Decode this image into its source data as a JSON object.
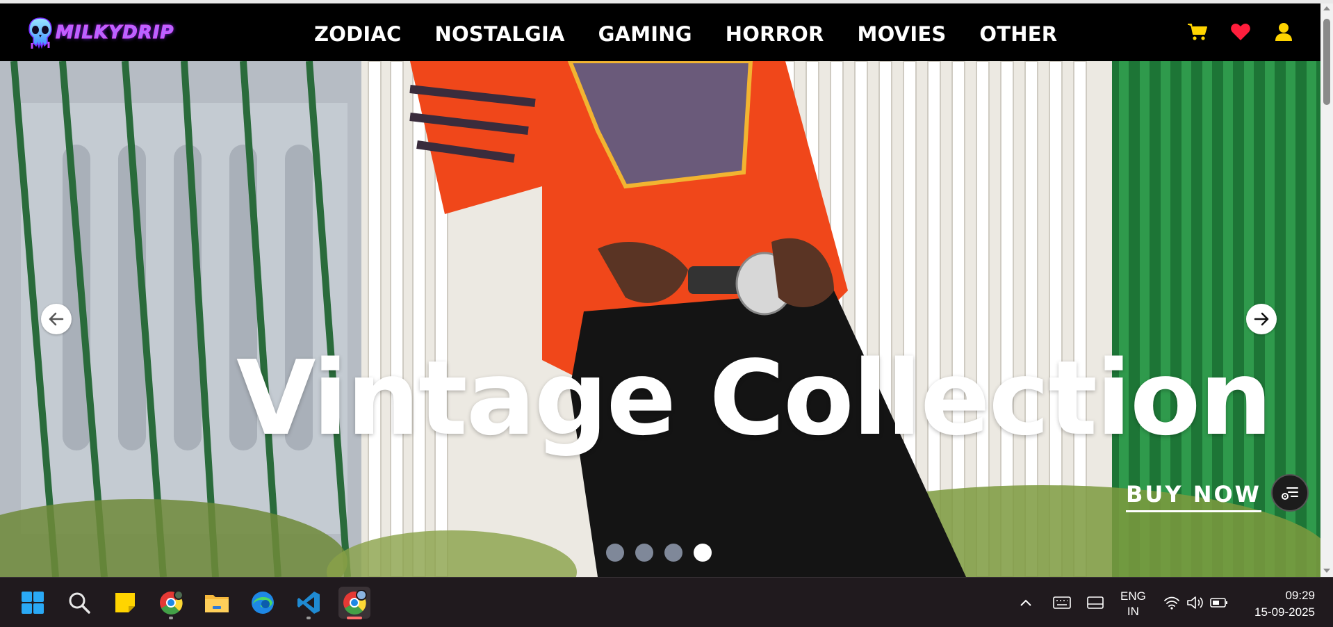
{
  "brand": {
    "name": "MILKYDRIP"
  },
  "nav": {
    "links": [
      "ZODIAC",
      "NOSTALGIA",
      "GAMING",
      "HORROR",
      "MOVIES",
      "OTHER"
    ]
  },
  "icons": {
    "cart": "cart-icon",
    "wishlist": "heart-icon",
    "account": "user-icon"
  },
  "colors": {
    "nav_bg": "#000000",
    "cart_accent": "#ffd400",
    "heart_accent": "#ff1e3c",
    "user_accent": "#ffd400",
    "dot_inactive": "#7f8899",
    "dot_active": "#ffffff",
    "taskbar_bg": "#201a1e"
  },
  "hero": {
    "title": "Vintage Collection",
    "cta": "BUY NOW",
    "slides": 4,
    "active_slide": 4
  },
  "taskbar": {
    "apps": [
      "start-icon",
      "search-icon",
      "sticky-notes-icon",
      "chrome-icon",
      "file-explorer-icon",
      "edge-icon",
      "vscode-icon",
      "chrome-profile-icon"
    ],
    "lang_line1": "ENG",
    "lang_line2": "IN",
    "time": "09:29",
    "date": "15-09-2025"
  }
}
